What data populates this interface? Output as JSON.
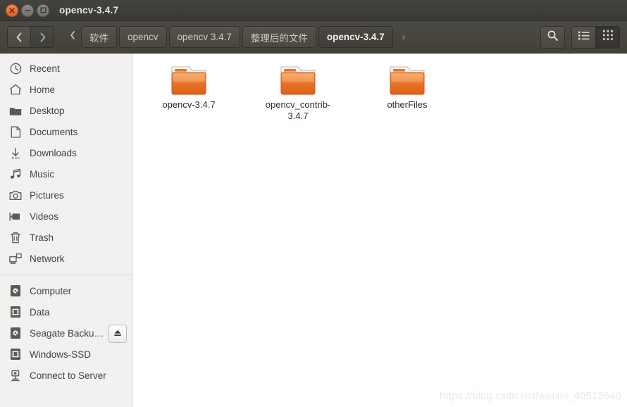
{
  "window": {
    "title": "opencv-3.4.7",
    "controls": {
      "close": "close-button",
      "minimize": "minimize-button",
      "maximize": "maximize-button"
    }
  },
  "toolbar": {
    "back_label": "Back",
    "forward_label": "Forward",
    "overflow_label": "Previous locations",
    "breadcrumbs": [
      {
        "label": "软件",
        "active": false
      },
      {
        "label": "opencv",
        "active": false
      },
      {
        "label": "opencv 3.4.7",
        "active": false
      },
      {
        "label": "整理后的文件",
        "active": false
      },
      {
        "label": "opencv-3.4.7",
        "active": true
      }
    ],
    "next_label": "›",
    "search_label": "Search",
    "list_view_label": "List view",
    "grid_view_label": "Icon view",
    "active_view": "grid"
  },
  "sidebar": {
    "groups": [
      {
        "items": [
          {
            "label": "Recent",
            "icon": "clock-icon"
          },
          {
            "label": "Home",
            "icon": "home-icon"
          },
          {
            "label": "Desktop",
            "icon": "folder-icon"
          },
          {
            "label": "Documents",
            "icon": "document-icon"
          },
          {
            "label": "Downloads",
            "icon": "download-icon"
          },
          {
            "label": "Music",
            "icon": "music-note-icon"
          },
          {
            "label": "Pictures",
            "icon": "camera-icon"
          },
          {
            "label": "Videos",
            "icon": "video-camera-icon"
          },
          {
            "label": "Trash",
            "icon": "trash-icon"
          },
          {
            "label": "Network",
            "icon": "network-icon"
          }
        ]
      },
      {
        "items": [
          {
            "label": "Computer",
            "icon": "drive-icon",
            "eject": false
          },
          {
            "label": "Data",
            "icon": "disk-icon",
            "eject": false
          },
          {
            "label": "Seagate Backu…",
            "icon": "drive-icon",
            "eject": true
          },
          {
            "label": "Windows-SSD",
            "icon": "disk-icon",
            "eject": false
          },
          {
            "label": "Connect to Server",
            "icon": "server-icon",
            "eject": false
          }
        ]
      }
    ]
  },
  "content": {
    "files": [
      {
        "name": "opencv-3.4.7",
        "type": "folder"
      },
      {
        "name": "opencv_contrib-3.4.7",
        "type": "folder"
      },
      {
        "name": "otherFiles",
        "type": "folder"
      }
    ]
  },
  "watermark": "https://blog.csdn.net/weixin_40512640",
  "colors": {
    "titlebar": "#3c3b37",
    "toolbar": "#474540",
    "sidebar": "#f2f1f0",
    "folder_orange": "#e8762a",
    "close_button": "#e2622b",
    "text_dark": "#2d2b28",
    "watermark": "#e8e8e8"
  }
}
